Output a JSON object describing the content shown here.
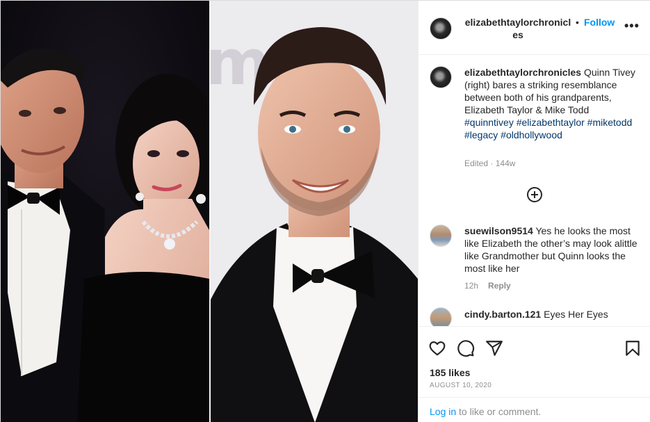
{
  "header": {
    "username": "elizabethtaylorchronicles",
    "separator": "•",
    "follow_label": "Follow",
    "more_label": "•••"
  },
  "caption": {
    "username": "elizabethtaylorchronicles",
    "text": "Quinn Tivey (right) bares a striking resemblance between both of his grandparents, Elizabeth Taylor & Mike Todd",
    "hashtags": [
      "#quinntivey",
      "#elizabethtaylor",
      "#miketodd",
      "#legacy",
      "#oldhollywood"
    ],
    "edited_label": "Edited",
    "separator": "·",
    "age": "144w"
  },
  "load_more": {
    "icon": "plus-circle-icon"
  },
  "comments": [
    {
      "username": "suewilson9514",
      "text": "Yes he looks the most like Elizabeth the other’s may look alittle like Grandmother but Quinn looks the most like her",
      "age": "12h",
      "reply_label": "Reply"
    },
    {
      "username": "cindy.barton.121",
      "text": "Eyes Her Eyes"
    }
  ],
  "actions": {
    "icons": [
      "heart-icon",
      "comment-icon",
      "share-icon",
      "bookmark-icon"
    ],
    "likes": "185 likes",
    "date": "AUGUST 10, 2020"
  },
  "login": {
    "link_label": "Log in",
    "rest_label": " to like or comment."
  },
  "colors": {
    "link_blue": "#0095f6",
    "hashtag": "#00376b",
    "muted": "#8e8e8e",
    "border": "#dbdbdb"
  }
}
